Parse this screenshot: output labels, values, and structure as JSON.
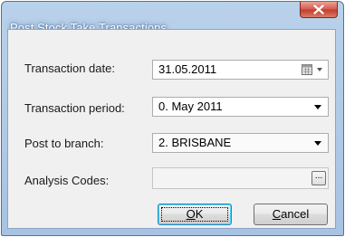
{
  "window": {
    "title": "Post Stock Take Transactions"
  },
  "form": {
    "transaction_date": {
      "label": "Transaction date:",
      "value": "31.05.2011"
    },
    "transaction_period": {
      "label": "Transaction period:",
      "value": "0. May 2011"
    },
    "post_to_branch": {
      "label": "Post to branch:",
      "value": "2. BRISBANE"
    },
    "analysis_codes": {
      "label": "Analysis Codes:",
      "value": "",
      "button": "..."
    }
  },
  "buttons": {
    "ok_mnemonic": "O",
    "ok_rest": "K",
    "cancel_mnemonic": "C",
    "cancel_rest": "ancel"
  },
  "icons": [
    "close-icon",
    "calendar-icon",
    "chevron-down-icon",
    "ellipsis-icon"
  ]
}
